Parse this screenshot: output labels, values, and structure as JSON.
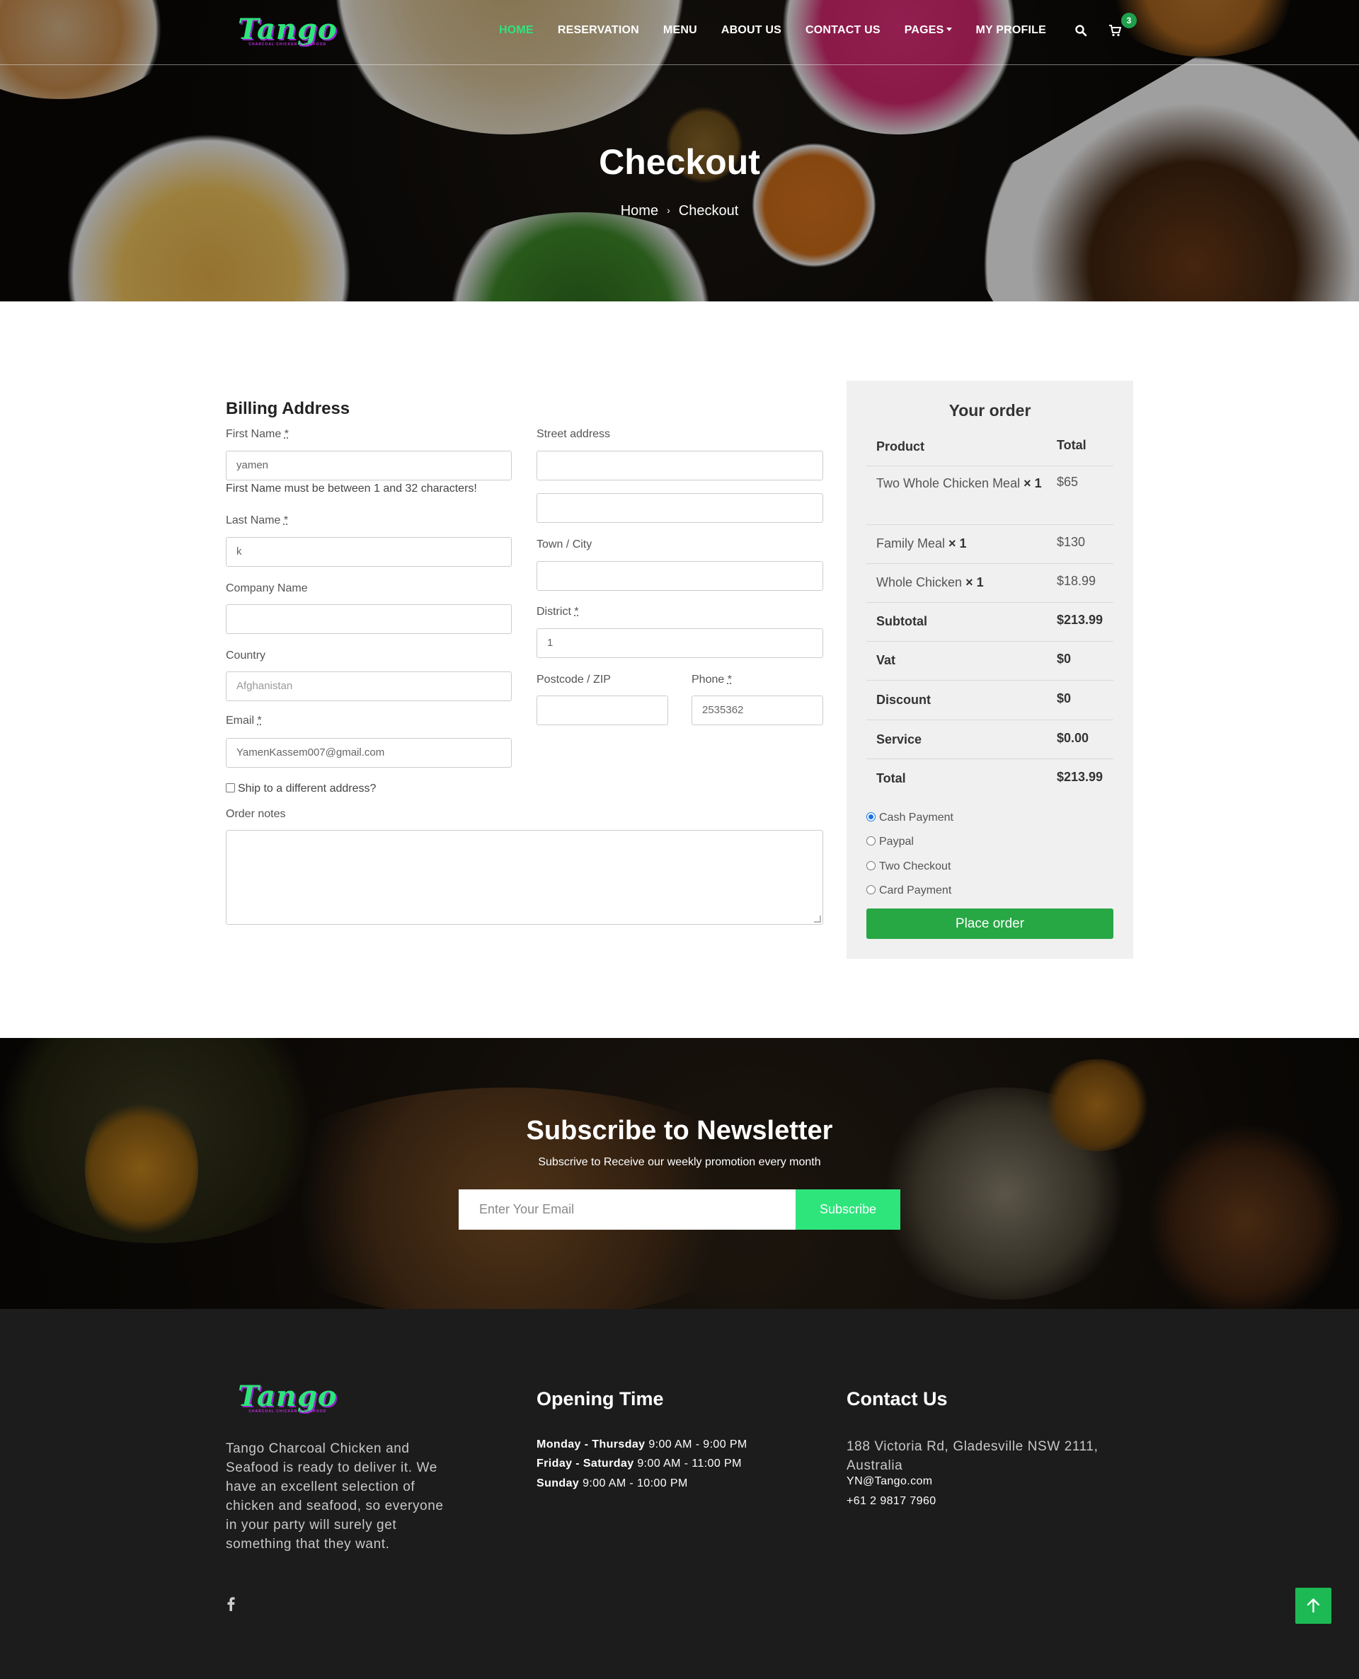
{
  "brand": {
    "name": "Tango",
    "tagline": "CHARCOAL CHICKEN & SEAFOOD"
  },
  "nav": {
    "items": [
      {
        "label": "HOME",
        "active": true
      },
      {
        "label": "RESERVATION"
      },
      {
        "label": "MENU"
      },
      {
        "label": "ABOUT US"
      },
      {
        "label": "CONTACT US"
      },
      {
        "label": "PAGES"
      },
      {
        "label": "MY PROFILE"
      }
    ],
    "cart_count": "3"
  },
  "hero": {
    "title": "Checkout",
    "breadcrumb": {
      "home": "Home",
      "separator": "›",
      "current": "Checkout"
    }
  },
  "billing": {
    "heading": "Billing Address",
    "required_mark": "*",
    "first_name": {
      "label": "First Name",
      "value": "yamen",
      "error": "First Name must be between 1 and 32 characters!"
    },
    "last_name": {
      "label": "Last Name",
      "value": "k"
    },
    "company": {
      "label": "Company Name",
      "value": ""
    },
    "country": {
      "label": "Country",
      "value": "Afghanistan"
    },
    "email": {
      "label": "Email",
      "value": "YamenKassem007@gmail.com"
    },
    "street": {
      "label": "Street address",
      "line1": "",
      "line2": ""
    },
    "town": {
      "label": "Town / City",
      "value": ""
    },
    "district": {
      "label": "District",
      "value": "1"
    },
    "postcode": {
      "label": "Postcode / ZIP",
      "value": ""
    },
    "phone": {
      "label": "Phone",
      "value": "2535362"
    },
    "ship_different": "Ship to a different address?",
    "order_notes": {
      "label": "Order notes",
      "value": ""
    }
  },
  "order": {
    "title": "Your order",
    "headers": {
      "product": "Product",
      "total": "Total"
    },
    "items": [
      {
        "name": "Two Whole Chicken Meal",
        "qty": "× 1",
        "total": "$65"
      },
      {
        "name": "Family Meal",
        "qty": "× 1",
        "total": "$130"
      },
      {
        "name": "Whole Chicken",
        "qty": "× 1",
        "total": "$18.99"
      }
    ],
    "summary": [
      {
        "label": "Subtotal",
        "value": "$213.99"
      },
      {
        "label": "Vat",
        "value": "$0"
      },
      {
        "label": "Discount",
        "value": "$0"
      },
      {
        "label": "Service",
        "value": "$0.00"
      },
      {
        "label": "Total",
        "value": "$213.99"
      }
    ],
    "payment_methods": [
      {
        "label": "Cash Payment",
        "selected": true
      },
      {
        "label": "Paypal",
        "selected": false
      },
      {
        "label": "Two Checkout",
        "selected": false
      },
      {
        "label": "Card Payment",
        "selected": false
      }
    ],
    "place_order": "Place order"
  },
  "newsletter": {
    "title": "Subscribe to Newsletter",
    "subtitle": "Subscrive to Receive our weekly promotion every month",
    "placeholder": "Enter Your Email",
    "button": "Subscribe"
  },
  "footer": {
    "about": "Tango Charcoal Chicken and Seafood is ready to deliver it. We have an excellent selection of chicken and seafood, so everyone in your party will surely get something that they want.",
    "opening": {
      "heading": "Opening Time",
      "rows": [
        {
          "days": "Monday - Thursday",
          "hours": "9:00 AM - 9:00 PM"
        },
        {
          "days": "Friday - Saturday",
          "hours": " 9:00 AM - 11:00 PM"
        },
        {
          "days": "Sunday",
          "hours": "9:00 AM - 10:00 PM"
        }
      ]
    },
    "contact": {
      "heading": "Contact Us",
      "address": "188 Victoria Rd, Gladesville NSW 2111, Australia",
      "email": "YN@Tango.com",
      "phone": "+61 2 9817 7960"
    }
  },
  "colors": {
    "accent_green": "#2ee57c",
    "place_order_green": "#28a745",
    "panel_bg": "#f0f0f0",
    "footer_bg": "#1c1c1c"
  }
}
